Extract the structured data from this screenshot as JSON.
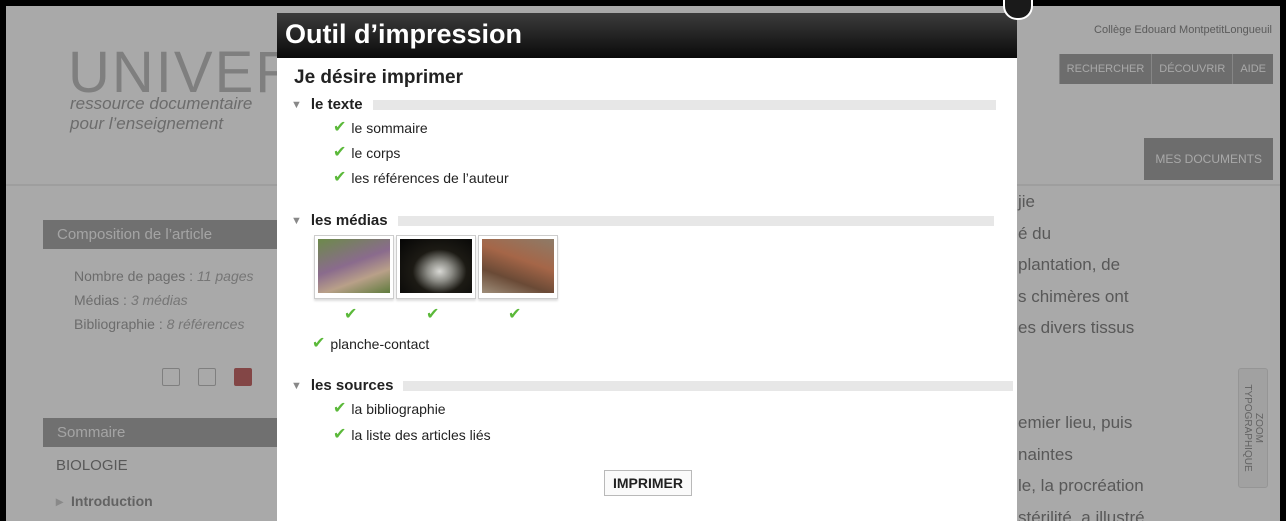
{
  "site": {
    "college": "Collège Edouard MontpetitLongueuil",
    "logo": "UNIVERS",
    "tagline": "ressource documentaire\npour l’enseignement",
    "nav": [
      "RECHERCHER",
      "DÉCOUVRIR",
      "AIDE"
    ],
    "mes_documents": "MES DOCUMENTS",
    "composition": {
      "title": "Composition de l’article",
      "pages_label": "Nombre de pages : ",
      "pages_value": "11 pages",
      "medias_label": "Médias : ",
      "medias_value": "3 médias",
      "biblio_label": "Bibliographie : ",
      "biblio_value": "8 références"
    },
    "sommaire": {
      "title": "Sommaire",
      "section": "BIOLOGIE",
      "first_item": "Introduction"
    },
    "article_text": "jie\né du\nplantation, de\ns chimères ont\nes divers tissus\n\n\nemier lieu, puis\nnaintes\nle, la procréation\nstérilité, a illustré",
    "zoom": "ZOOM\nTYPOGRAPHIQUE"
  },
  "modal": {
    "title": "Outil d’impression",
    "subtitle": "Je désire imprimer",
    "text_section": {
      "label": "le texte",
      "items": [
        "le sommaire",
        "le corps",
        "les références de l’auteur"
      ]
    },
    "media_section": {
      "label": "les médias",
      "thumbnails": [
        "media-thumbnail-1",
        "media-thumbnail-2",
        "media-thumbnail-3"
      ],
      "contact_sheet": "planche-contact"
    },
    "sources_section": {
      "label": "les sources",
      "items": [
        "la bibliographie",
        "la liste des articles liés"
      ]
    },
    "print_button": "IMPRIMER"
  },
  "colors": {
    "check": "#5bb93a",
    "modal_header": "#111111",
    "nav": "#8a8a8a"
  }
}
